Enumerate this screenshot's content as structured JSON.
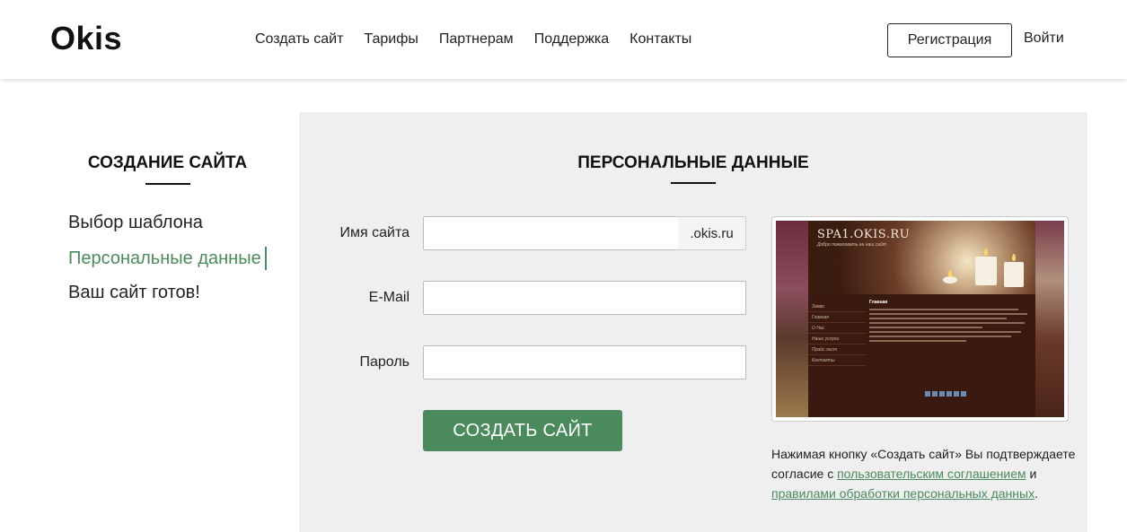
{
  "header": {
    "logo": "Okis",
    "nav": [
      "Создать сайт",
      "Тарифы",
      "Партнерам",
      "Поддержка",
      "Контакты"
    ],
    "register_label": "Регистрация",
    "login_label": "Войти"
  },
  "sidebar": {
    "title": "СОЗДАНИЕ САЙТА",
    "items": [
      {
        "label": "Выбор шаблона",
        "active": false
      },
      {
        "label": "Персональные данные",
        "active": true
      },
      {
        "label": "Ваш сайт готов!",
        "active": false
      }
    ]
  },
  "form": {
    "title": "ПЕРСОНАЛЬНЫЕ ДАННЫЕ",
    "site_name_label": "Имя сайта",
    "site_name_value": "",
    "site_suffix": ".okis.ru",
    "email_label": "E-Mail",
    "email_value": "",
    "password_label": "Пароль",
    "password_value": "",
    "submit_label": "СОЗДАТЬ САЙТ"
  },
  "preview": {
    "site_title": "SPA1.OKIS.RU",
    "tagline": "Добро пожаловать на наш сайт",
    "menu": [
      "Заяво",
      "Главная",
      "О Нас",
      "Наши услуги",
      "Прайс лист",
      "Контакты"
    ],
    "content_heading": "Главная"
  },
  "agreement": {
    "text_before": "Нажимая кнопку «Создать сайт» Вы подтверждаете согласие с ",
    "link1": "пользовательским соглашением",
    "text_middle": " и ",
    "link2": "правилами обработки персональных данных",
    "text_after": "."
  },
  "colors": {
    "accent": "#4a8a5c",
    "panel_bg": "#efefef"
  }
}
